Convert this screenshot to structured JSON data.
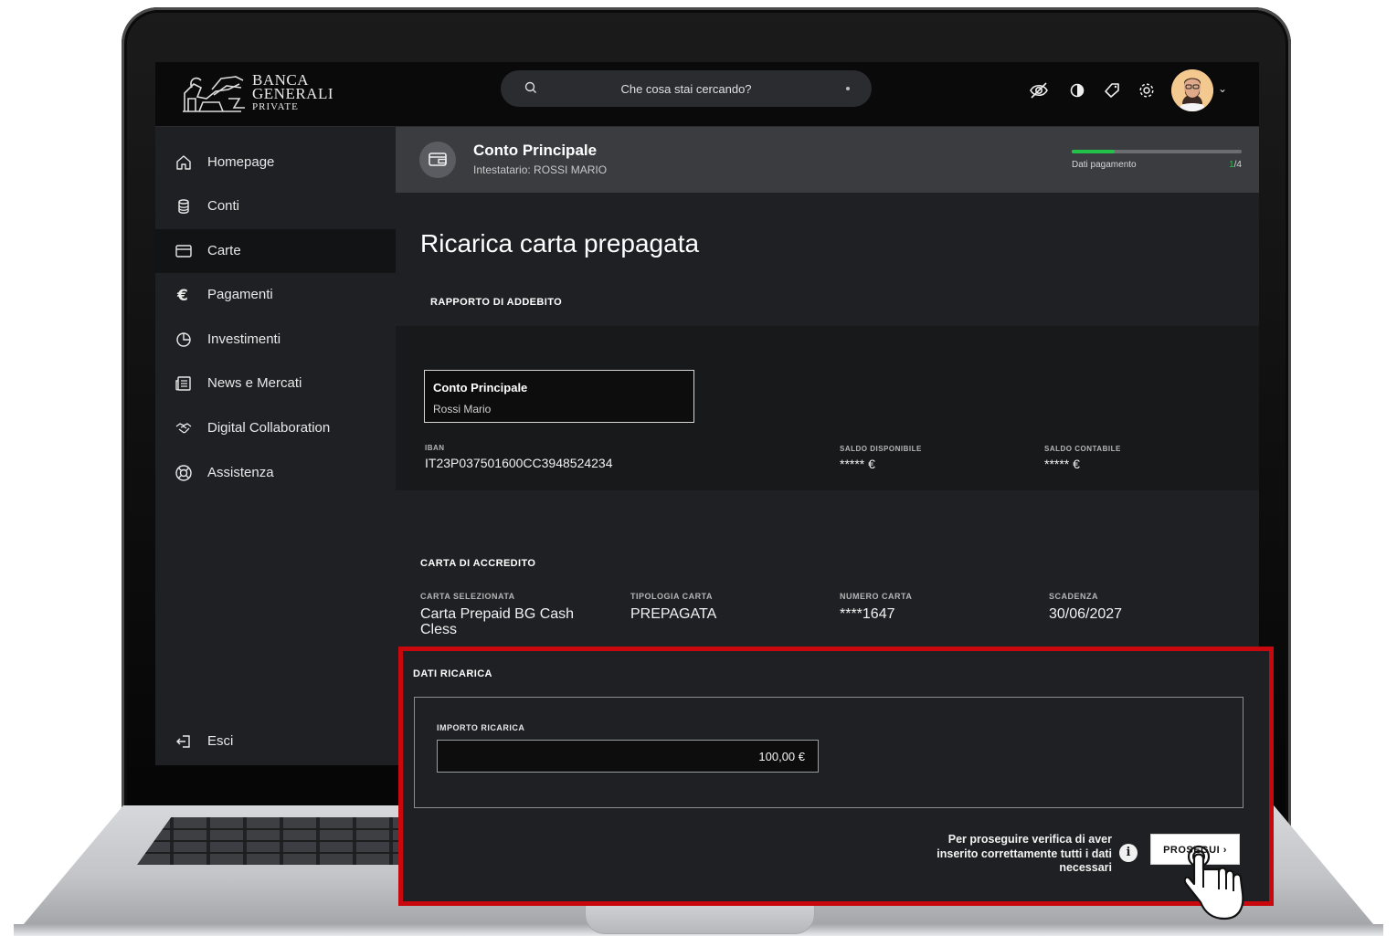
{
  "brand": {
    "line1": "BANCA",
    "line2": "GENERALI",
    "line3": "PRIVATE"
  },
  "search": {
    "placeholder": "Che cosa stai cercando?"
  },
  "toolbar_icons": [
    "eye-off-icon",
    "contrast-icon",
    "tag-icon",
    "gear-icon"
  ],
  "sidebar": {
    "items": [
      {
        "label": "Homepage",
        "icon": "home-icon",
        "active": false
      },
      {
        "label": "Conti",
        "icon": "database-icon",
        "active": false
      },
      {
        "label": "Carte",
        "icon": "card-icon",
        "active": true
      },
      {
        "label": "Pagamenti",
        "icon": "euro-icon",
        "active": false
      },
      {
        "label": "Investimenti",
        "icon": "pie-chart-icon",
        "active": false
      },
      {
        "label": "News e Mercati",
        "icon": "newspaper-icon",
        "active": false
      },
      {
        "label": "Digital Collaboration",
        "icon": "handshake-icon",
        "active": false
      },
      {
        "label": "Assistenza",
        "icon": "lifebuoy-icon",
        "active": false
      }
    ],
    "logout": "Esci"
  },
  "account_header": {
    "title": "Conto Principale",
    "subtitle": "Intestatario: ROSSI MARIO",
    "progress_label": "Dati pagamento",
    "progress_current": "1",
    "progress_total": "/4",
    "progress_fraction": 0.25
  },
  "page_title": "Ricarica carta prepagata",
  "debit": {
    "section_label": "RAPPORTO DI ADDEBITO",
    "account_name": "Conto Principale",
    "account_holder": "Rossi Mario",
    "iban_label": "IBAN",
    "iban": "IT23P037501600CC3948524234",
    "available_label": "SALDO DISPONIBILE",
    "available_value": "***** €",
    "accounting_label": "SALDO CONTABILE",
    "accounting_value": "***** €"
  },
  "credit": {
    "section_label": "CARTA DI ACCREDITO",
    "card_label": "CARTA SELEZIONATA",
    "card_line1": "Carta Prepaid BG Cash",
    "card_line2": "Cless",
    "type_label": "TIPOLOGIA CARTA",
    "type_value": "PREPAGATA",
    "number_label": "NUMERO CARTA",
    "number_value": "****1647",
    "expiry_label": "SCADENZA",
    "expiry_value": "30/06/2027"
  },
  "recharge": {
    "section_label": "DATI RICARICA",
    "amount_label": "IMPORTO RICARICA",
    "amount_value": "100,00 €",
    "hint_line1": "Per proseguire verifica di aver",
    "hint_line2": "inserito correttamente tutti i dati",
    "hint_line3": "necessari",
    "info_glyph": "i",
    "proceed_label": "PROSEGUI ›"
  },
  "colors": {
    "highlight_border": "#c8080d",
    "progress_green": "#22c24a",
    "background": "#1f2023"
  }
}
